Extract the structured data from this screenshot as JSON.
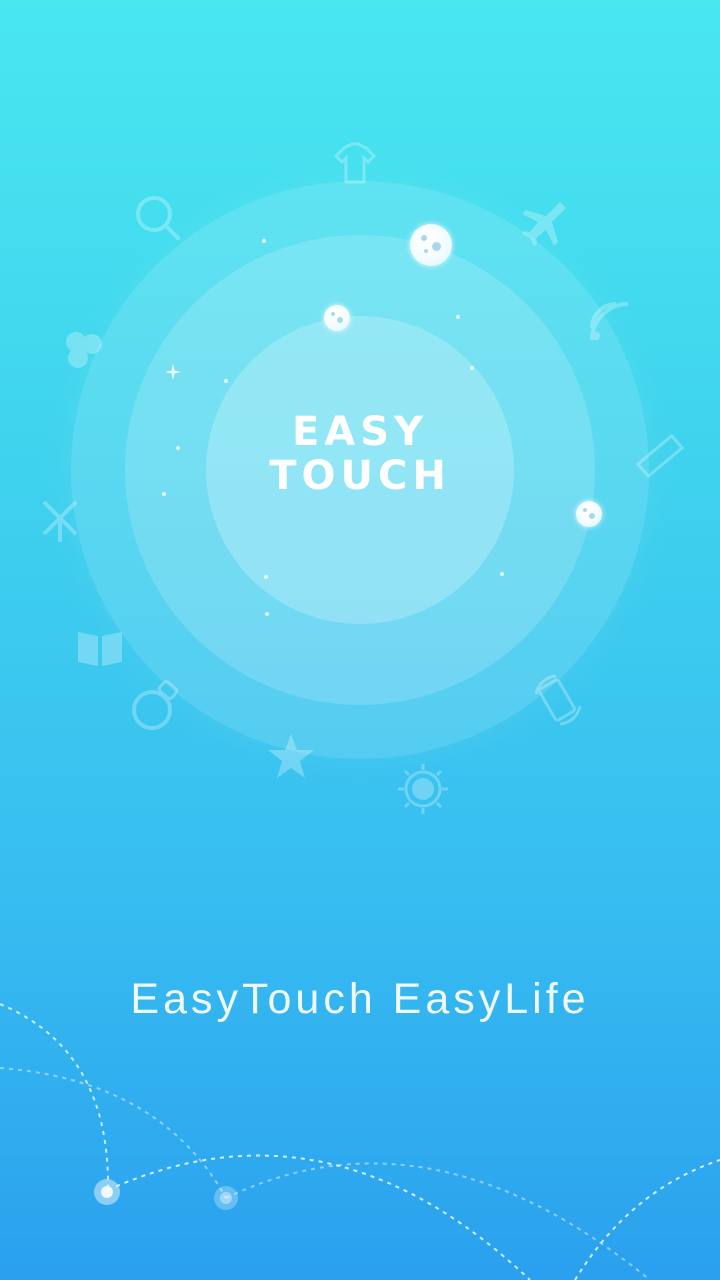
{
  "logo": {
    "line1": "EASY",
    "line2": "TOUCH"
  },
  "tagline": "EasyTouch EasyLife",
  "background_icons": [
    "search-icon",
    "shirt-icon",
    "airplane-icon",
    "wifi-icon",
    "ruler-icon",
    "windmill-icon",
    "book-icon",
    "lightbulb-icon",
    "star-icon",
    "sun-icon",
    "rotate-screen-icon",
    "clover-icon"
  ],
  "colors": {
    "gradient_top": "#49e7f0",
    "gradient_bottom": "#2aa0ee",
    "text": "#ffffff"
  }
}
